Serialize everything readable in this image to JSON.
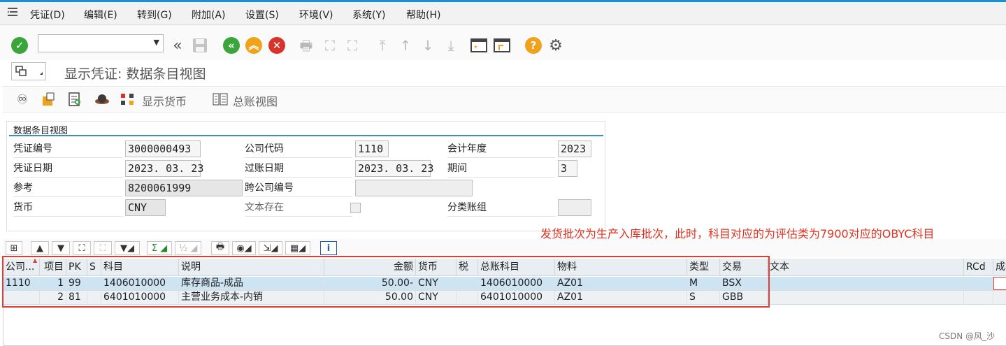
{
  "menubar": {
    "glyph_icon": "menu-expand-icon",
    "items": [
      "凭证(D)",
      "编辑(E)",
      "转到(G)",
      "附加(A)",
      "设置(S)",
      "环境(V)",
      "系统(Y)",
      "帮助(H)"
    ]
  },
  "toolbar": {
    "command_value": "",
    "icons": [
      "enter-icon",
      "back-double-icon",
      "save-icon",
      "back-icon",
      "exit-icon",
      "cancel-icon",
      "print-icon",
      "find-icon",
      "find-next-icon",
      "first-page-icon",
      "previous-page-icon",
      "next-page-icon",
      "last-page-icon",
      "create-session-icon",
      "shortcut-icon",
      "help-icon",
      "customize-layout-icon"
    ]
  },
  "titlebar": {
    "title": "显示凭证: 数据条目视图"
  },
  "app_toolbar": {
    "display_currency_label": "显示货币",
    "ledger_view_label": "总账视图",
    "icons": [
      "change-display-icon",
      "document-overview-icon",
      "select-icon",
      "hat-icon",
      "currency-icon",
      "ledger-icon"
    ]
  },
  "group": {
    "title": "数据条目视图",
    "fields": {
      "doc_number_label": "凭证编号",
      "doc_number": "3000000493",
      "company_code_label": "公司代码",
      "company_code": "1110",
      "fiscal_year_label": "会计年度",
      "fiscal_year": "2023",
      "doc_date_label": "凭证日期",
      "doc_date": "2023. 03. 23",
      "posting_date_label": "过账日期",
      "posting_date": "2023. 03. 23",
      "period_label": "期间",
      "period": "3",
      "reference_label": "参考",
      "reference": "8200061999",
      "cross_cc_label": "跨公司编号",
      "cross_cc": "",
      "currency_label": "货币",
      "currency": "CNY",
      "text_exists_label": "文本存在",
      "ledger_group_label": "分类账组",
      "ledger_group": ""
    }
  },
  "annotation": "发货批次为生产入库批次，此时，科目对应的为评估类为7900对应的OBYC科目",
  "grid": {
    "columns": [
      "公司...",
      "项目",
      "PK",
      "S",
      "科目",
      "说明",
      "金额",
      "货币",
      "税",
      "总账科目",
      "物料",
      "类型",
      "交易",
      "文本",
      "RCd",
      "成本"
    ],
    "rows": [
      {
        "company": "1110",
        "item": "1",
        "pk": "99",
        "s": "",
        "account": "1406010000",
        "desc": "库存商品-成品",
        "amount": "50.00-",
        "currency": "CNY",
        "tax": "",
        "gl": "1406010000",
        "material": "AZ01",
        "type": "M",
        "trans": "BSX",
        "text": "",
        "rcd": ""
      },
      {
        "company": "",
        "item": "2",
        "pk": "81",
        "s": "",
        "account": "6401010000",
        "desc": "主营业务成本-内销",
        "amount": "50.00",
        "currency": "CNY",
        "tax": "",
        "gl": "6401010000",
        "material": "AZ01",
        "type": "S",
        "trans": "GBB",
        "text": "",
        "rcd": ""
      }
    ]
  },
  "watermark": "CSDN @风_沙",
  "colors": {
    "accent": "#1a8fd3",
    "annotation": "#e0301e",
    "selected_row": "#cfe4f3",
    "ok_green": "#3aa53a",
    "back_orange": "#f0a21a",
    "cancel_red": "#d9322b"
  }
}
